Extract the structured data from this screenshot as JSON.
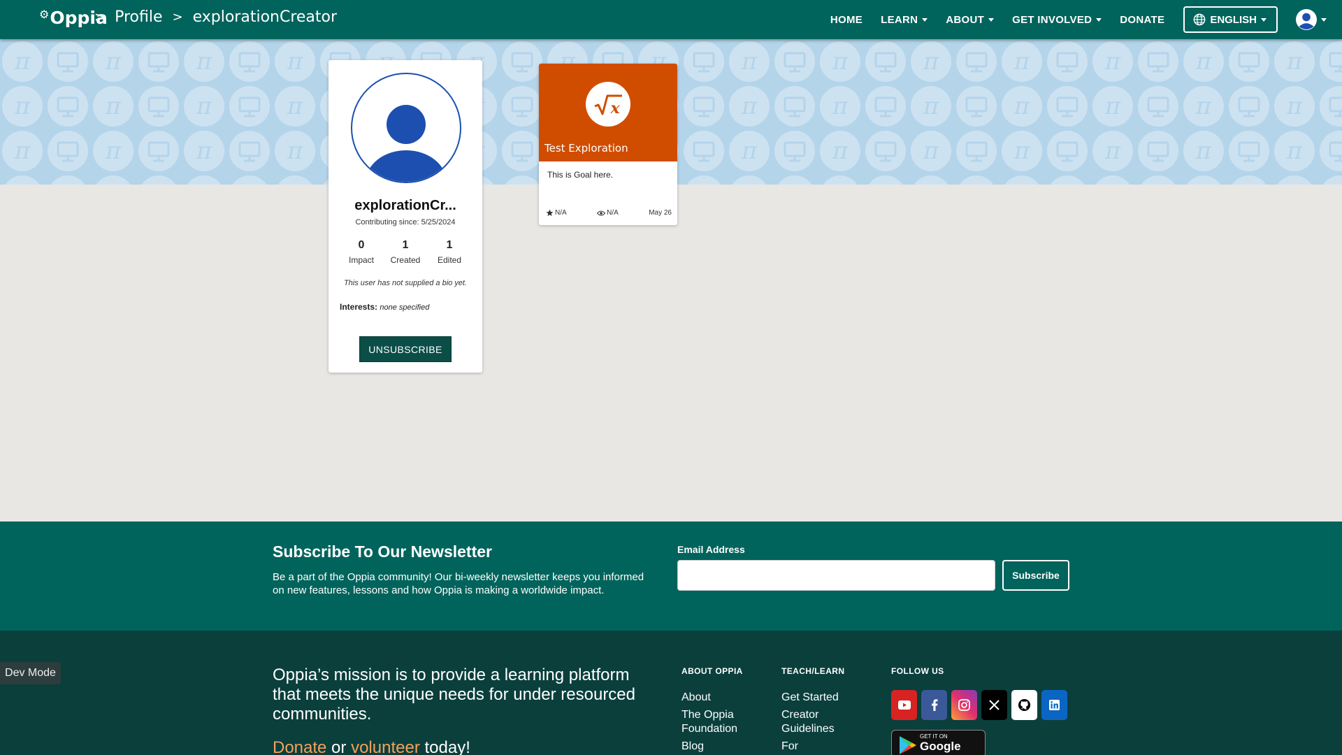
{
  "header": {
    "logo": "Oppia",
    "breadcrumbs": [
      "Profile",
      "explorationCreator"
    ],
    "separator": ">",
    "nav": {
      "home": "HOME",
      "learn": "LEARN",
      "about": "ABOUT",
      "get_involved": "GET INVOLVED",
      "donate": "DONATE",
      "language": "ENGLISH"
    },
    "colors": {
      "primary": "#00645c",
      "banner": "#b4d4ea"
    }
  },
  "profile": {
    "username": "explorationCr...",
    "contributing_since": "Contributing since: 5/25/2024",
    "stats": [
      {
        "value": "0",
        "label": "Impact"
      },
      {
        "value": "1",
        "label": "Created"
      },
      {
        "value": "1",
        "label": "Edited"
      }
    ],
    "bio": "This user has not supplied a bio yet.",
    "interests_label": "Interests:",
    "interests_value": "none specified",
    "unsubscribe_label": "UNSUBSCRIBE"
  },
  "exploration": {
    "title": "Test Exploration",
    "goal": "This is Goal here.",
    "rating": "N/A",
    "views": "N/A",
    "date": "May 26",
    "thumb_color": "#d04d00",
    "icon": "square-root-x-icon"
  },
  "newsletter": {
    "title": "Subscribe To Our Newsletter",
    "description": "Be a part of the Oppia community! Our bi-weekly newsletter keeps you informed on new features, lessons and how Oppia is making a worldwide impact.",
    "email_label": "Email Address",
    "email_value": "",
    "subscribe_label": "Subscribe"
  },
  "footer": {
    "mission": "Oppia’s mission is to provide a learning platform that meets the unique needs for under resourced communities.",
    "cta_donate": "Donate",
    "cta_or": " or ",
    "cta_volunteer": "volunteer",
    "cta_end": " today!",
    "about_heading": "ABOUT OPPIA",
    "about_links": [
      "About",
      "The Oppia Foundation",
      "Blog"
    ],
    "teach_heading": "TEACH/LEARN",
    "teach_links": [
      "Get Started",
      "Creator Guidelines",
      "For"
    ],
    "follow_heading": "FOLLOW US",
    "socials": [
      "youtube-icon",
      "facebook-icon",
      "instagram-icon",
      "x-icon",
      "github-icon",
      "linkedin-icon"
    ],
    "google_play_small": "GET IT ON",
    "google_play_big": "Google Play"
  },
  "dev_mode": "Dev Mode"
}
